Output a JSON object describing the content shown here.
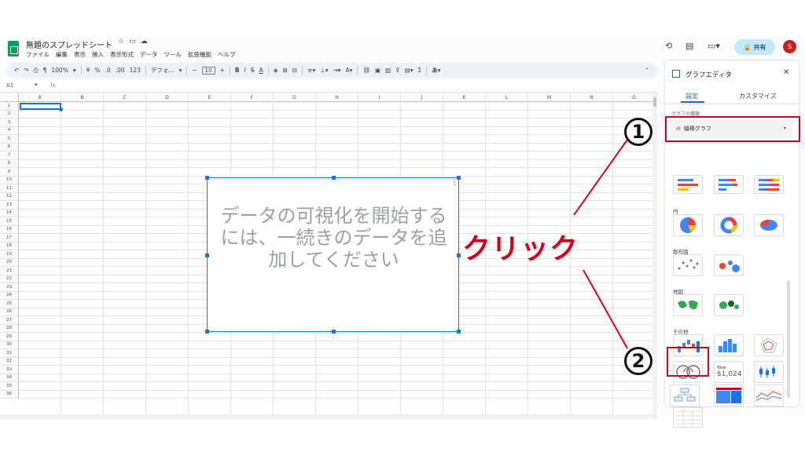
{
  "doc": {
    "title": "無題のスプレッドシート",
    "menu": [
      "ファイル",
      "編集",
      "表示",
      "挿入",
      "表示形式",
      "データ",
      "ツール",
      "拡張機能",
      "ヘルプ"
    ]
  },
  "header": {
    "share_label": "共有",
    "avatar_initial": "S"
  },
  "toolbar": {
    "zoom": "100%",
    "currency": "¥",
    "percent": "%",
    "decimal_dec": ".0",
    "decimal_inc": ".00",
    "number_format": "123",
    "font": "デフォ...",
    "font_size": "10"
  },
  "formula_bar": {
    "cell_ref": "A1",
    "fx": "fx"
  },
  "grid": {
    "columns": [
      "A",
      "B",
      "C",
      "D",
      "E",
      "F",
      "G",
      "H",
      "I",
      "J",
      "K",
      "L",
      "M",
      "N",
      "O"
    ],
    "rows": [
      "1",
      "2",
      "3",
      "4",
      "5",
      "6",
      "7",
      "8",
      "9",
      "10",
      "11",
      "12",
      "13",
      "14",
      "15",
      "16",
      "17",
      "18",
      "19",
      "20",
      "21",
      "22",
      "23",
      "24",
      "25",
      "26",
      "27",
      "28",
      "29",
      "30",
      "31",
      "32",
      "33",
      "34",
      "35",
      "36"
    ]
  },
  "chart": {
    "message": "データの可視化を開始するには、一続きのデータを追加してください"
  },
  "panel": {
    "title": "グラフエディタ",
    "tab_setup": "設定",
    "tab_customize": "カスタマイズ",
    "chart_type_label": "グラフの種類",
    "chart_type_value": "縦棒グラフ",
    "categories": {
      "pie": "円",
      "scatter": "散布図",
      "map": "地図",
      "other": "その他"
    },
    "scorecard_total": "Total",
    "scorecard_value": "$1,024"
  },
  "annotations": {
    "step1": "1",
    "step2": "2",
    "click_label": "クリック",
    "color": "#d0021b"
  }
}
